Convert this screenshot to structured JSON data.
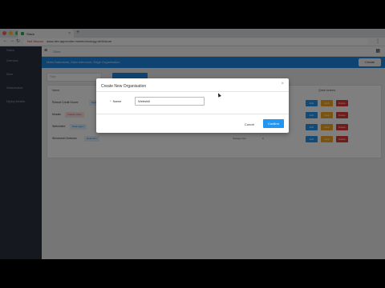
{
  "browser": {
    "tab_title": "Stack",
    "insecure_label": "Not Secure",
    "url": "www.dev.appcenter.meetechnology.de/#/store",
    "nav_icons": [
      "back-arrow-icon",
      "forward-arrow-icon",
      "reload-icon"
    ]
  },
  "sidebar": {
    "brand": "Stack",
    "items": [
      {
        "label": "Overview"
      },
      {
        "label": "Store"
      },
      {
        "label": "Infrastructure"
      },
      {
        "label": "Deploy Models"
      }
    ]
  },
  "topbar": {
    "label": "Store"
  },
  "banner": {
    "text": "Meta Datensets, Data inference, Edge Organisation",
    "create_label": "Create"
  },
  "filter": {
    "placeholder": "Filter"
  },
  "table": {
    "col_name": "Name",
    "col_actions": "Quick Actions",
    "rows": [
      {
        "name": "Robust Credit Scorer",
        "badge": "Model"
      },
      {
        "name": "Mosaic",
        "badge": "Feature store"
      },
      {
        "name": "Webshield",
        "badge": "Data Agent"
      },
      {
        "name": "Windmesh Detector",
        "badge": "Detection"
      }
    ],
    "extra_col": "Storage size",
    "extra_val": "0",
    "btn_edit": "Edit",
    "btn_warn": "Clear",
    "btn_delete": "Delete",
    "colors": {
      "blue": "#2196f3",
      "orange": "#f5a623",
      "red": "#e53935"
    }
  },
  "modal": {
    "title": "Create New Organisation",
    "name_label": "Name",
    "name_value": "Webshill",
    "cancel_label": "Cancel",
    "confirm_label": "Confirm"
  }
}
